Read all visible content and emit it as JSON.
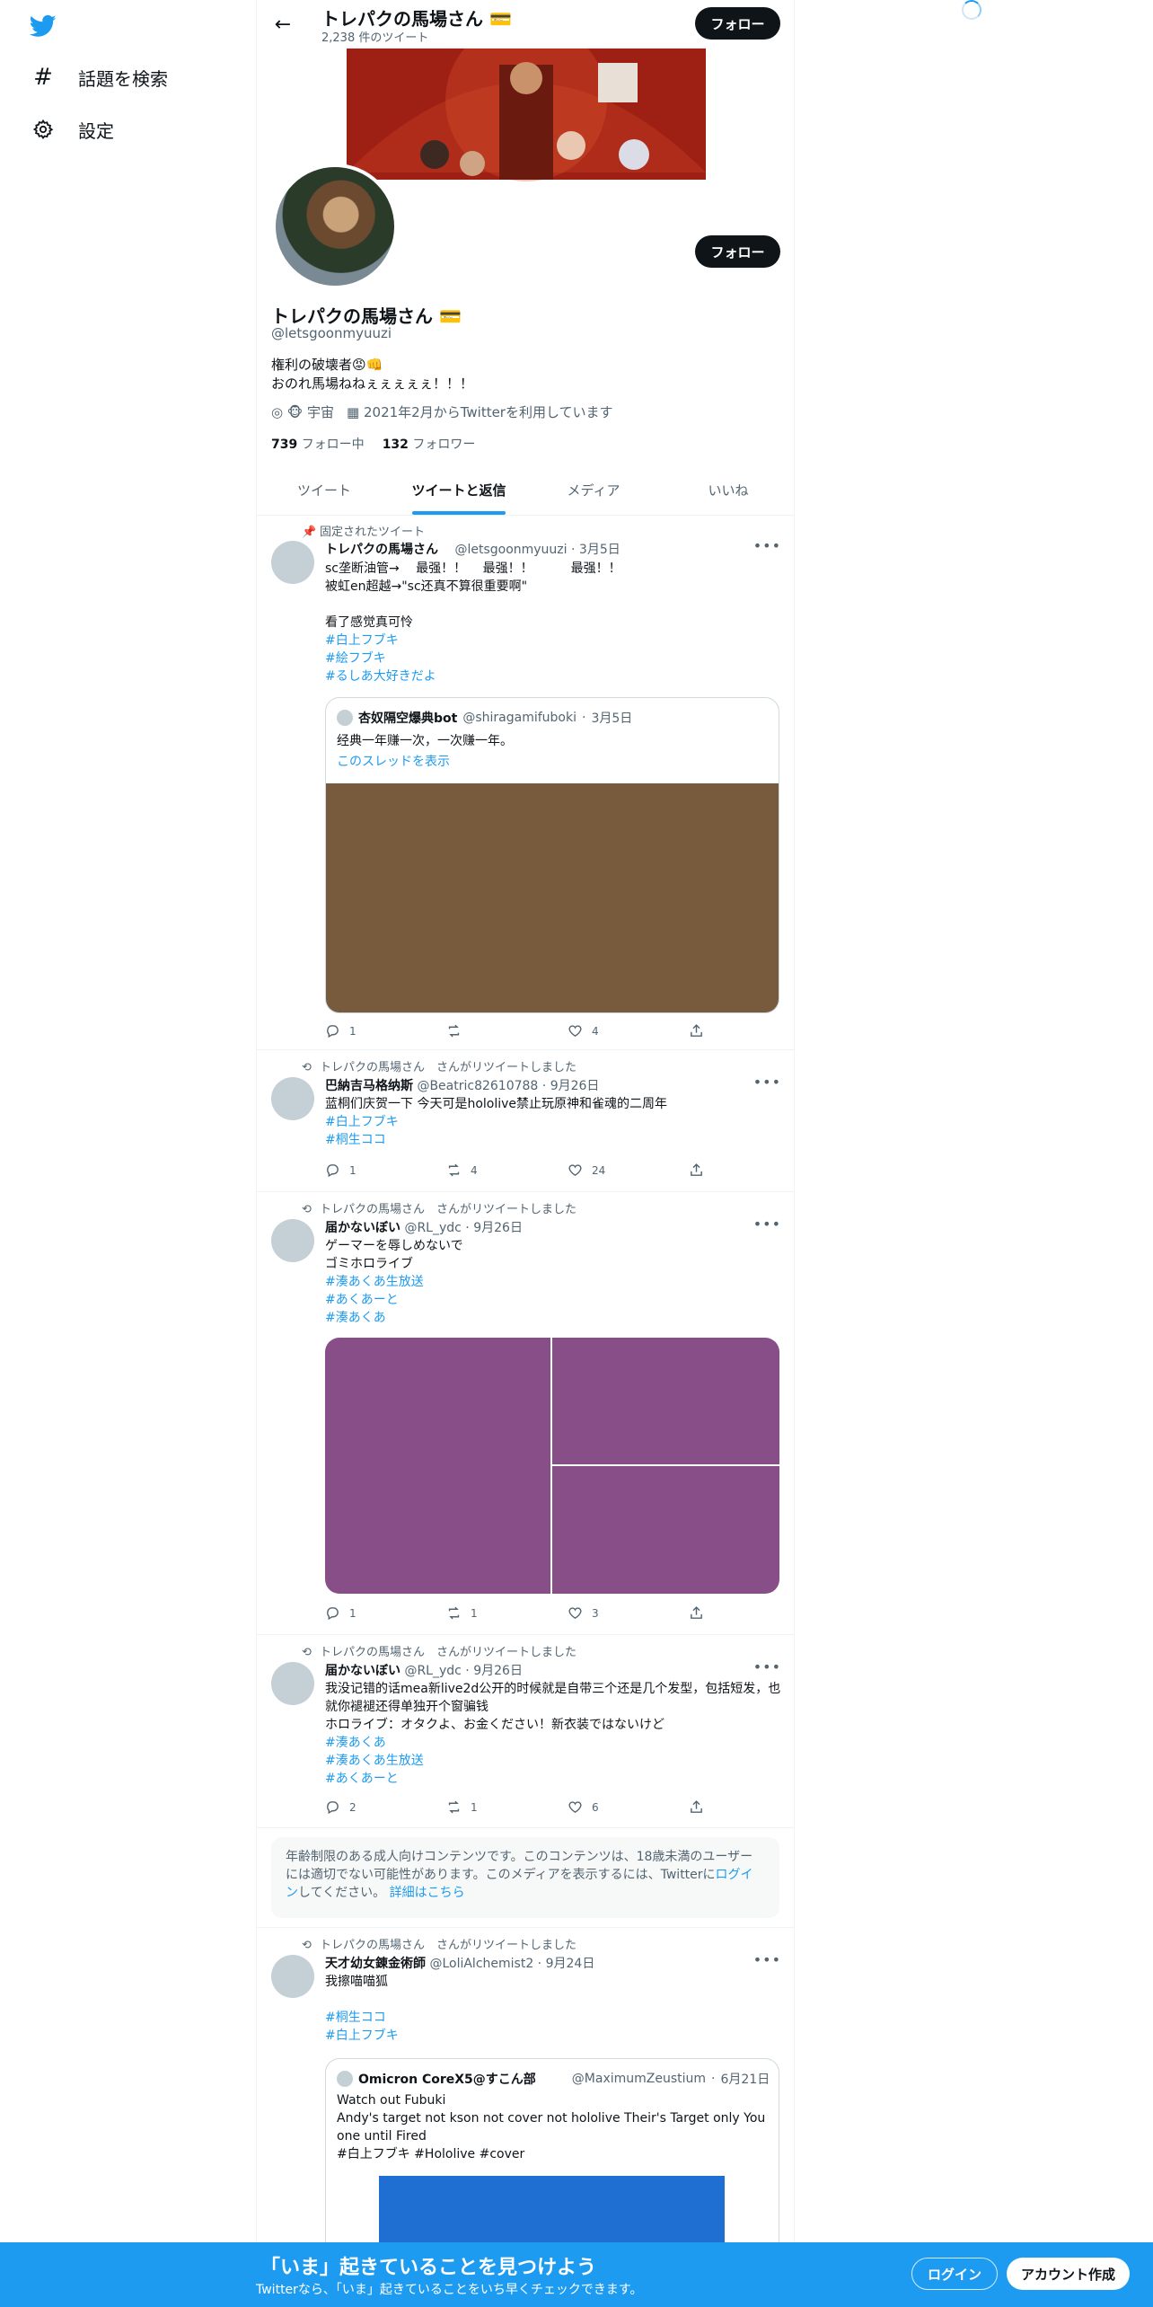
{
  "nav": {
    "logo_icon": "twitter-bird-icon",
    "items": [
      {
        "label": "話題を検索",
        "icon": "hashtag-icon"
      },
      {
        "label": "設定",
        "icon": "gear-icon"
      }
    ]
  },
  "header": {
    "name": "トレパクの馬場さん",
    "tweet_count": "2,238 件のツイート",
    "follow_label": "フォロー"
  },
  "profile": {
    "name": "トレパクの馬場さん",
    "handle": "@letsgoonmyuuzi",
    "bio": "権利の破壊者😡👊\nおのれ馬場ねねぇぇぇぇぇ！！！",
    "location": "宇宙",
    "joined": "2021年2月からTwitterを利用しています",
    "following_count": "739",
    "following_label": "フォロー中",
    "followers_count": "132",
    "followers_label": "フォロワー",
    "follow_label": "フォロー"
  },
  "tabs": [
    {
      "label": "ツイート",
      "active": false
    },
    {
      "label": "ツイートと返信",
      "active": true
    },
    {
      "label": "メディア",
      "active": false
    },
    {
      "label": "いいね",
      "active": false
    }
  ],
  "tweets": {
    "t1": {
      "context": "固定されたツイート",
      "name": "トレパクの馬場さん",
      "handle": "@letsgoonmyuuzi",
      "date": "3月5日",
      "text": "sc垄断油管→　 最强！！　 最强！！　　　最强！！\n被虹en超越→\"sc还真不算很重要啊\"\n\n看了感觉真可怜",
      "hashtags": [
        "#白上フブキ",
        "#絵フブキ",
        "#るしあ大好きだよ"
      ],
      "quote": {
        "name": "杏奴隔空爆典bot",
        "handle": "@shiragamifuboki",
        "date": "3月5日",
        "text": "经典一年赚一次，一次赚一年。",
        "link": "このスレッドを表示",
        "media_color": "#785a3c"
      },
      "replies": "1",
      "retweets": "",
      "likes": "4"
    },
    "t2": {
      "context": "トレパクの馬場さん　さんがリツイートしました",
      "name": "巴納吉马格纳斯",
      "handle": "@Beatric82610788",
      "date": "9月26日",
      "text": "蓝桐们庆贺一下 今天可是hololive禁止玩原神和雀魂的二周年",
      "hashtags": [
        "#白上フブキ",
        "#桐生ココ"
      ],
      "replies": "1",
      "retweets": "4",
      "likes": "24"
    },
    "t3": {
      "context": "トレパクの馬場さん　さんがリツイートしました",
      "name": "届かないぼい",
      "handle": "@RL_ydc",
      "date": "9月26日",
      "text": "ゲーマーを辱しめないで\nゴミホロライブ",
      "hashtags": [
        "#湊あくあ生放送",
        "#あくあーと",
        "#湊あくあ"
      ],
      "media_color": "#874e87",
      "replies": "1",
      "retweets": "1",
      "likes": "3"
    },
    "t4": {
      "context": "トレパクの馬場さん　さんがリツイートしました",
      "name": "届かないぼい",
      "handle": "@RL_ydc",
      "date": "9月26日",
      "text": "我没记错的话mea新live2d公开的时候就是自带三个还是几个发型，包括短发，也就你褪褪还得单独开个窗骗钱\nホロライブ：オタクよ、お金ください！新衣装ではないけど",
      "hashtags": [
        "#湊あくあ",
        "#湊あくあ生放送",
        "#あくあーと"
      ],
      "replies": "2",
      "retweets": "1",
      "likes": "6"
    },
    "t5": {
      "context": "トレパクの馬場さん　さんがリツイートしました",
      "name": "天才幼女錬金術師",
      "handle": "@LoliAlchemist2",
      "date": "9月24日",
      "text": "我擦喵喵狐",
      "hashtags": [
        "#桐生ココ",
        "#白上フブキ"
      ],
      "quote": {
        "name": "Omicron CoreX5@すこん部",
        "handle": "@MaximumZeustium",
        "date": "6月21日",
        "text": "Watch out Fubuki\nAndy's target not kson not cover not hololive Their's Target only You one until Fired\n#白上フブキ #Hololive #cover",
        "media_color": "#1f6ed2"
      }
    }
  },
  "notice": {
    "text_before": "年齢制限のある成人向けコンテンツです。このコンテンツは、18歳未満のユーザーには適切でない可能性があります。このメディアを表示するには、Twitterに",
    "login_link": "ログイン",
    "text_mid": "してください。",
    "details_link": "詳細はこちら"
  },
  "bottom_bar": {
    "title": "「いま」起きていることを見つけよう",
    "subtitle": "Twitterなら、「いま」起きていることをいち早くチェックできます。",
    "login": "ログイン",
    "signup": "アカウント作成"
  },
  "colors": {
    "accent": "#1d9bf0",
    "dark": "#0f1419",
    "secondary_text": "#536471"
  }
}
